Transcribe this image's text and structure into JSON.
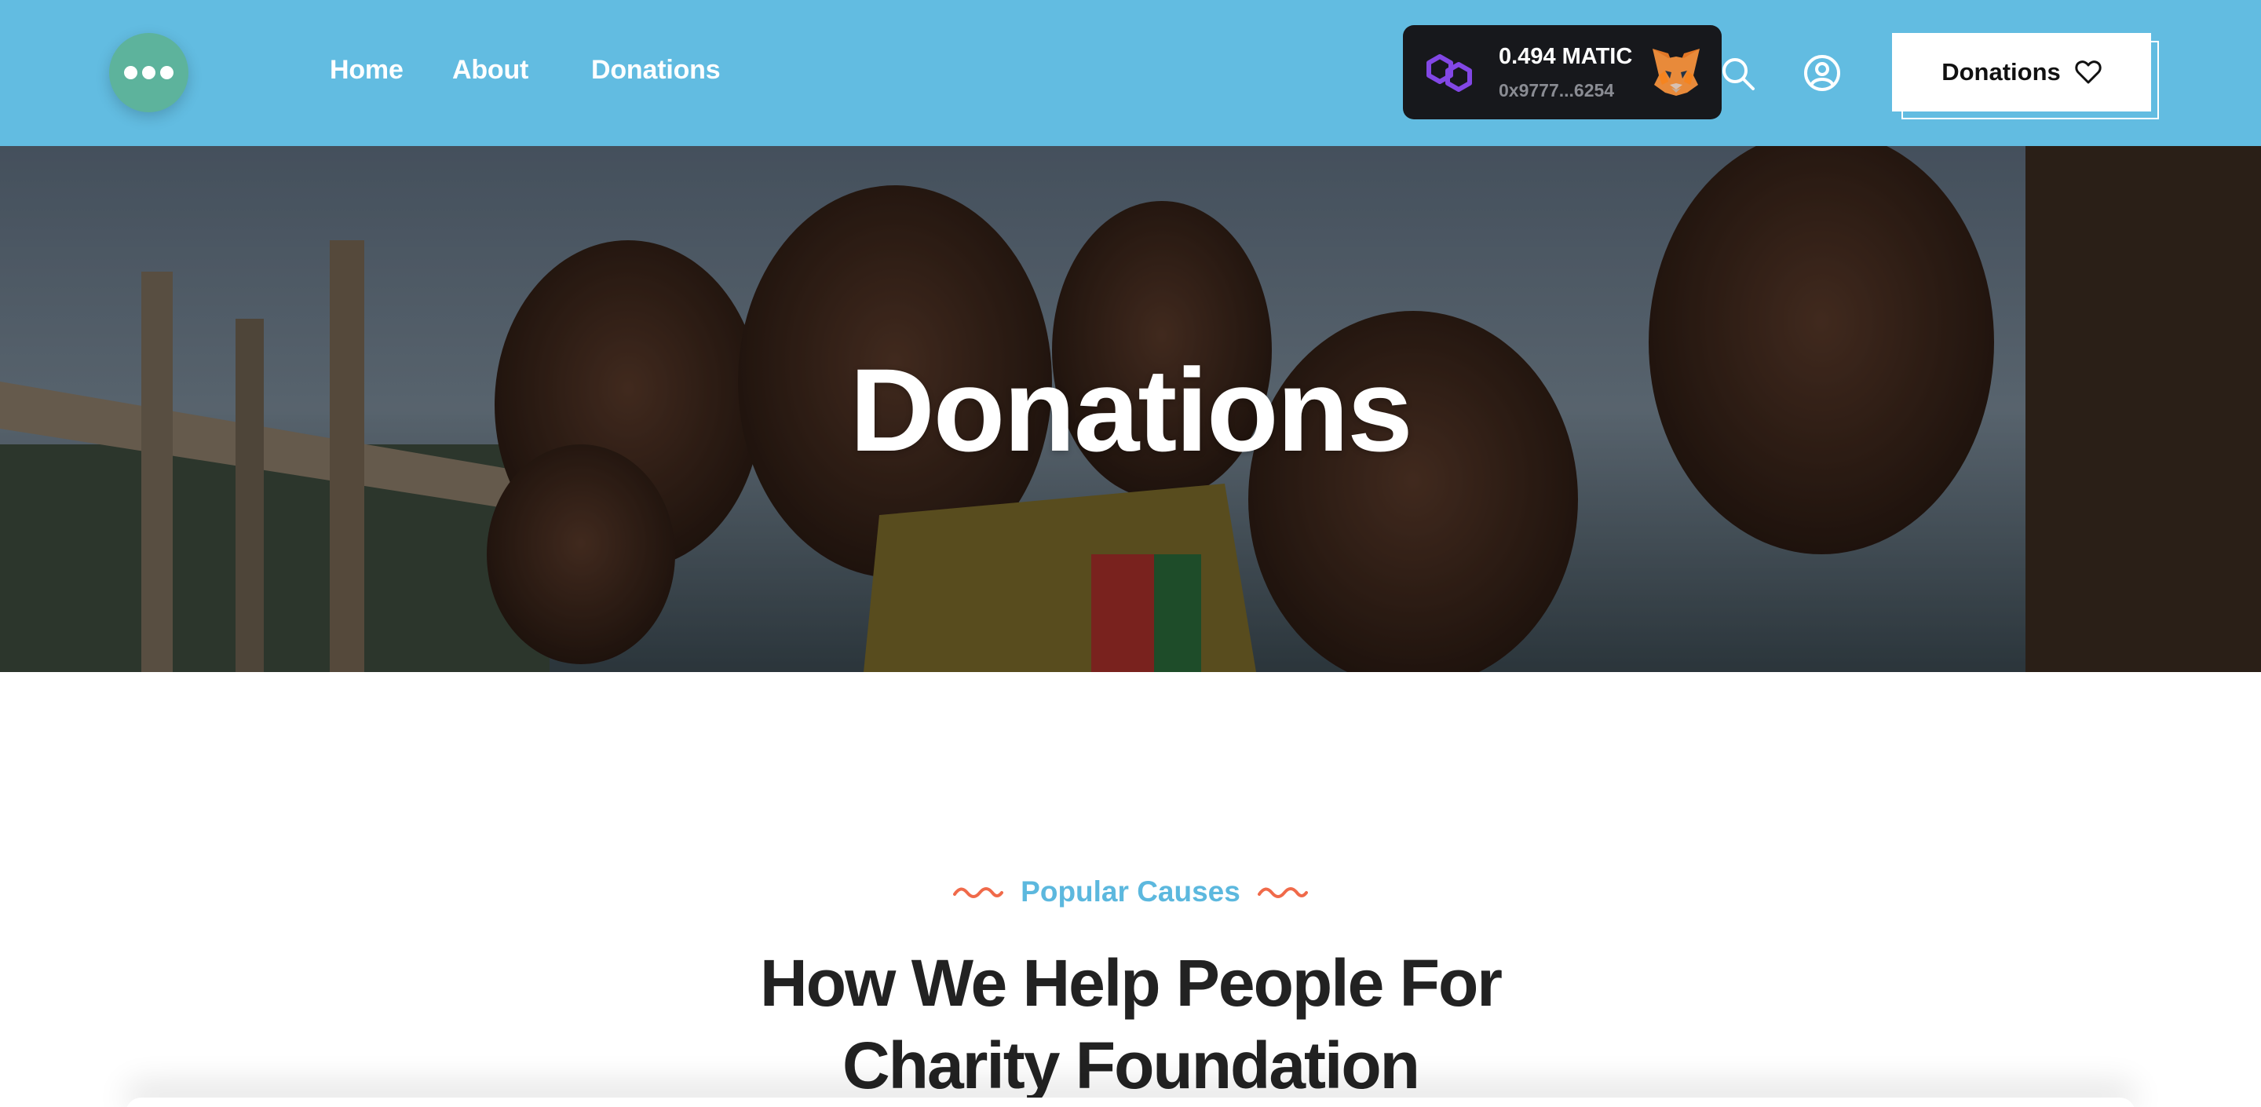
{
  "header": {
    "logo_icon": "more-dots-icon",
    "nav": {
      "home": "Home",
      "about": "About",
      "donations": "Donations"
    },
    "wallet": {
      "balance": "0.494 MATIC",
      "address": "0x9777...6254",
      "network_icon": "polygon-icon",
      "wallet_icon": "metamask-fox-icon"
    },
    "search_icon": "search-icon",
    "account_icon": "user-circle-icon",
    "donate_button": {
      "label": "Donations",
      "icon": "heart-icon"
    }
  },
  "hero": {
    "title": "Donations"
  },
  "section": {
    "tag": "Popular Causes",
    "title_line1": "How We Help People For",
    "title_line2": "Charity Foundation"
  },
  "colors": {
    "header_bg": "#62bce1",
    "logo_bg": "#5db39c",
    "accent_text": "#5cb8de",
    "squiggle": "#f06a4a",
    "wallet_bg": "#17181c",
    "polygon_purple": "#8247e5",
    "heading_text": "#222222"
  }
}
